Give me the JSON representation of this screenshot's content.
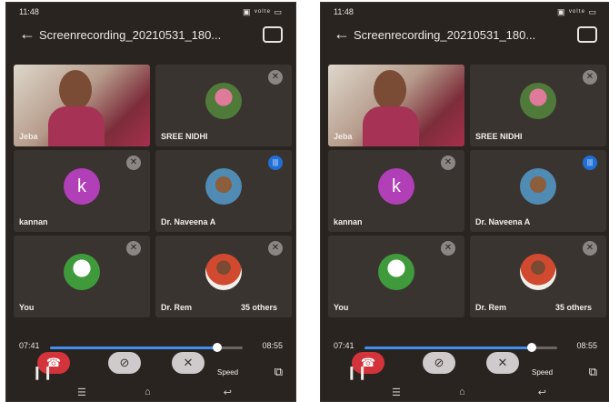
{
  "screens": [
    {
      "status_time": "11:48",
      "status_icons": "▣ ᵛᵒˡᵗᵉ ▭",
      "title": "Screenrecording_20210531_180...",
      "tiles": [
        {
          "name": "Jeba"
        },
        {
          "name": "SREE NIDHI"
        },
        {
          "name": "kannan",
          "letter": "k"
        },
        {
          "name": "Dr. Naveena A"
        },
        {
          "name": "You"
        },
        {
          "name": "Dr. Rem",
          "others": "35 others"
        }
      ],
      "player": {
        "current": "07:41",
        "total": "08:55",
        "progress": 0.87,
        "speed_label": "Speed"
      }
    },
    {
      "status_time": "11:48",
      "status_icons": "▣ ᵛᵒˡᵗᵉ ▭",
      "title": "Screenrecording_20210531_180...",
      "tiles": [
        {
          "name": "Jeba"
        },
        {
          "name": "SREE NIDHI"
        },
        {
          "name": "kannan",
          "letter": "k"
        },
        {
          "name": "Dr. Naveena A"
        },
        {
          "name": "You"
        },
        {
          "name": "Dr. Rem",
          "others": "35 others"
        }
      ],
      "player": {
        "current": "07:41",
        "total": "08:55",
        "progress": 0.87,
        "speed_label": "Speed"
      }
    }
  ],
  "icons": {
    "back": "back-arrow-icon",
    "rotate": "rotate-screen-icon",
    "mute": "mic-muted-icon",
    "speaking": "speaking-indicator-icon",
    "end_call": "end-call-icon",
    "camera_off": "camera-off-icon",
    "mic_off": "mic-off-icon",
    "pause": "pause-icon",
    "crop": "crop-icon",
    "nav_menu": "menu-icon",
    "nav_home": "home-icon",
    "nav_back": "back-icon"
  },
  "colors": {
    "accent": "#3e8ff0",
    "end_call": "#d3333a",
    "kannan_avatar": "#b03fb8",
    "speaking": "#1f6fd8"
  }
}
